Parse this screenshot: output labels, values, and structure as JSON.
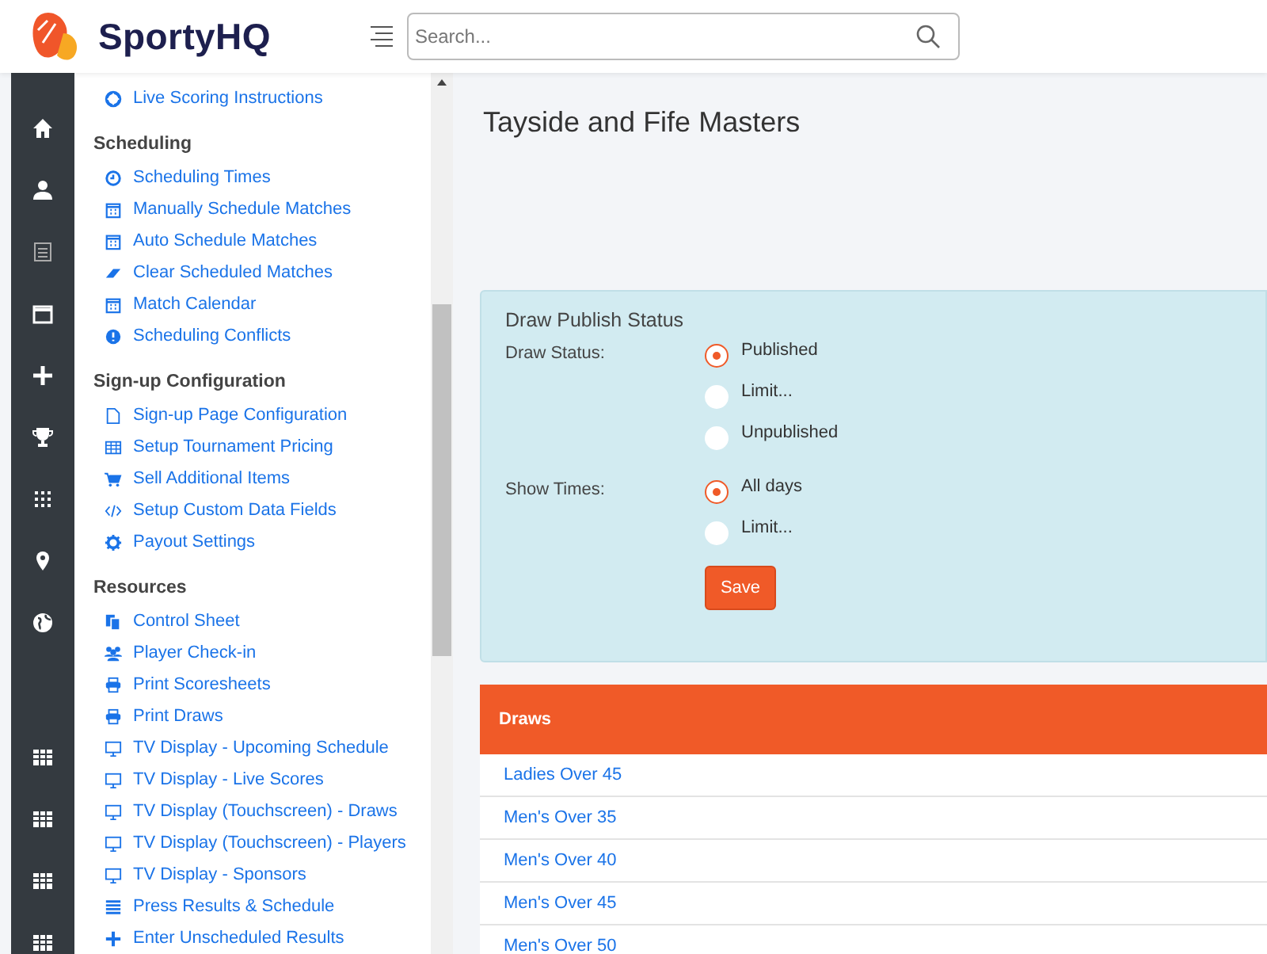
{
  "header": {
    "brand": "SportyHQ",
    "search": {
      "placeholder": "Search..."
    }
  },
  "rail": [
    {
      "kind": "home"
    },
    {
      "kind": "user"
    },
    {
      "kind": "list"
    },
    {
      "kind": "calendar"
    },
    {
      "kind": "plus"
    },
    {
      "kind": "trophy"
    },
    {
      "kind": "dots"
    },
    {
      "kind": "pin"
    },
    {
      "kind": "globe"
    },
    {
      "kind": "gap"
    },
    {
      "kind": "table"
    },
    {
      "kind": "table"
    },
    {
      "kind": "table"
    },
    {
      "kind": "table"
    }
  ],
  "menu": [
    {
      "items": [
        {
          "label": "Live Scoring Instructions",
          "kind": "lifering"
        }
      ]
    },
    {
      "heading": "Scheduling",
      "items": [
        {
          "label": "Scheduling Times",
          "kind": "clock"
        },
        {
          "label": "Manually Schedule Matches",
          "kind": "calendar"
        },
        {
          "label": "Auto Schedule Matches",
          "kind": "calendar"
        },
        {
          "label": "Clear Scheduled Matches",
          "kind": "eraser"
        },
        {
          "label": "Match Calendar",
          "kind": "calendar"
        },
        {
          "label": "Scheduling Conflicts",
          "kind": "alert"
        }
      ]
    },
    {
      "heading": "Sign-up Configuration",
      "items": [
        {
          "label": "Sign-up Page Configuration",
          "kind": "page"
        },
        {
          "label": "Setup Tournament Pricing",
          "kind": "table"
        },
        {
          "label": "Sell Additional Items",
          "kind": "cart"
        },
        {
          "label": "Setup Custom Data Fields",
          "kind": "code"
        },
        {
          "label": "Payout Settings",
          "kind": "gear"
        }
      ]
    },
    {
      "heading": "Resources",
      "items": [
        {
          "label": "Control Sheet",
          "kind": "copy"
        },
        {
          "label": "Player Check-in",
          "kind": "users"
        },
        {
          "label": "Print Scoresheets",
          "kind": "printer"
        },
        {
          "label": "Print Draws",
          "kind": "printer"
        },
        {
          "label": "TV Display - Upcoming Schedule",
          "kind": "monitor"
        },
        {
          "label": "TV Display - Live Scores",
          "kind": "monitor"
        },
        {
          "label": "TV Display (Touchscreen) - Draws",
          "kind": "monitor"
        },
        {
          "label": "TV Display (Touchscreen) - Players",
          "kind": "monitor"
        },
        {
          "label": "TV Display - Sponsors",
          "kind": "monitor"
        },
        {
          "label": "Press Results & Schedule",
          "kind": "lines"
        },
        {
          "label": "Enter Unscheduled Results",
          "kind": "plus"
        }
      ]
    }
  ],
  "page_title": "Tayside and Fife Masters",
  "publish": {
    "title": "Draw Publish Status",
    "groups": [
      {
        "label": "Draw Status:",
        "options": [
          {
            "label": "Published",
            "selected": true
          },
          {
            "label": "Limit...",
            "selected": false
          },
          {
            "label": "Unpublished",
            "selected": false
          }
        ]
      },
      {
        "label": "Show Times:",
        "options": [
          {
            "label": "All days",
            "selected": true
          },
          {
            "label": "Limit...",
            "selected": false
          }
        ]
      }
    ],
    "save": "Save"
  },
  "draws": {
    "heading": "Draws",
    "rows": [
      "Ladies Over 45",
      "Men's Over 35",
      "Men's Over 40",
      "Men's Over 45",
      "Men's Over 50"
    ]
  }
}
